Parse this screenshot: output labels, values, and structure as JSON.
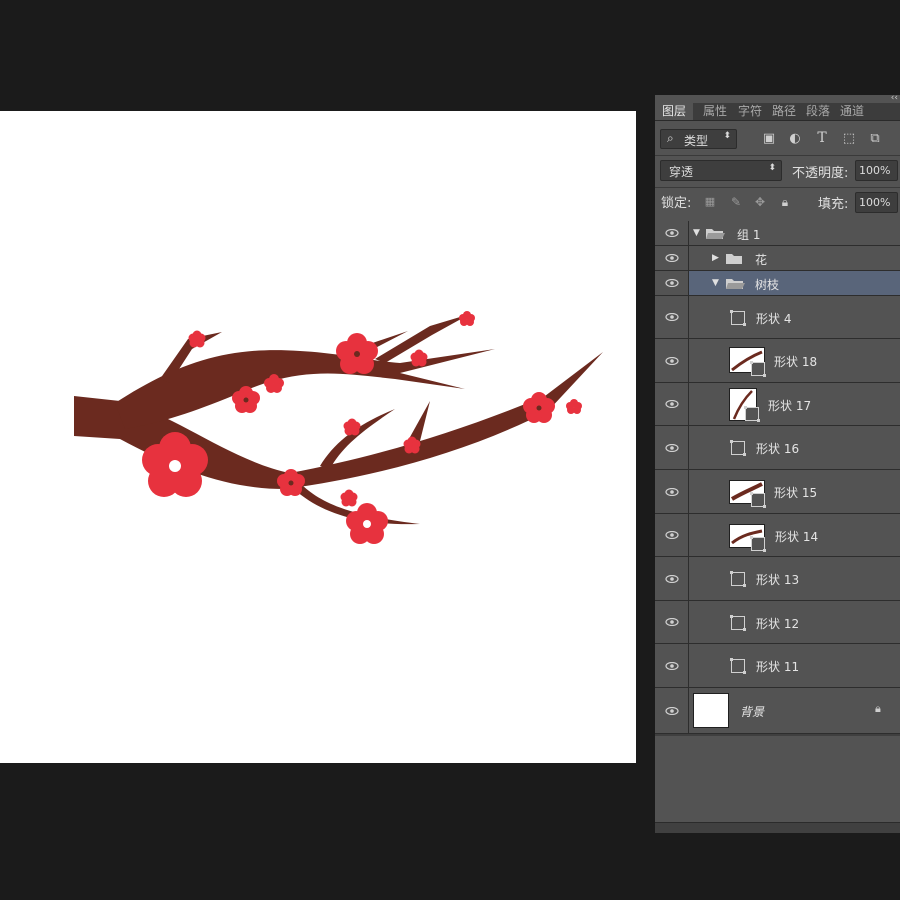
{
  "panel": {
    "collapse_glyph": "‹‹",
    "tabs": [
      {
        "label": "图层",
        "active": true
      },
      {
        "label": "属性",
        "active": false
      },
      {
        "label": "字符",
        "active": false
      },
      {
        "label": "路径",
        "active": false
      },
      {
        "label": "段落",
        "active": false
      },
      {
        "label": "通道",
        "active": false
      }
    ],
    "filter": {
      "kind_label": "类型",
      "icons": [
        "image-filter-icon",
        "adjustment-filter-icon",
        "type-filter-icon",
        "shape-filter-icon",
        "smart-object-filter-icon"
      ]
    },
    "blend_mode": "穿透",
    "opacity_label": "不透明度:",
    "opacity_value": "100%",
    "lock_label": "锁定:",
    "fill_label": "填充:",
    "fill_value": "100%",
    "layers": [
      {
        "name": "组 1",
        "type": "group",
        "expanded": true
      },
      {
        "name": "花",
        "type": "group",
        "expanded": false
      },
      {
        "name": "树枝",
        "type": "group",
        "expanded": true,
        "selected": true
      },
      {
        "name": "形状 4",
        "type": "shape"
      },
      {
        "name": "形状 18",
        "type": "shape-thumb"
      },
      {
        "name": "形状 17",
        "type": "shape-thumb"
      },
      {
        "name": "形状 16",
        "type": "shape"
      },
      {
        "name": "形状 15",
        "type": "shape-thumb"
      },
      {
        "name": "形状 14",
        "type": "shape-thumb"
      },
      {
        "name": "形状 13",
        "type": "shape"
      },
      {
        "name": "形状 12",
        "type": "shape"
      },
      {
        "name": "形状 11",
        "type": "shape"
      },
      {
        "name": "背景",
        "type": "background",
        "locked": true
      }
    ],
    "footer_icons": [
      "link-icon",
      "fx-icon",
      "mask-icon",
      "adjustment-icon",
      "folder-icon",
      "new-layer-icon",
      "trash-icon"
    ]
  },
  "colors": {
    "branch": "#6b2a1f",
    "blossom": "#e7323e",
    "selected_layer": "#59657a"
  }
}
